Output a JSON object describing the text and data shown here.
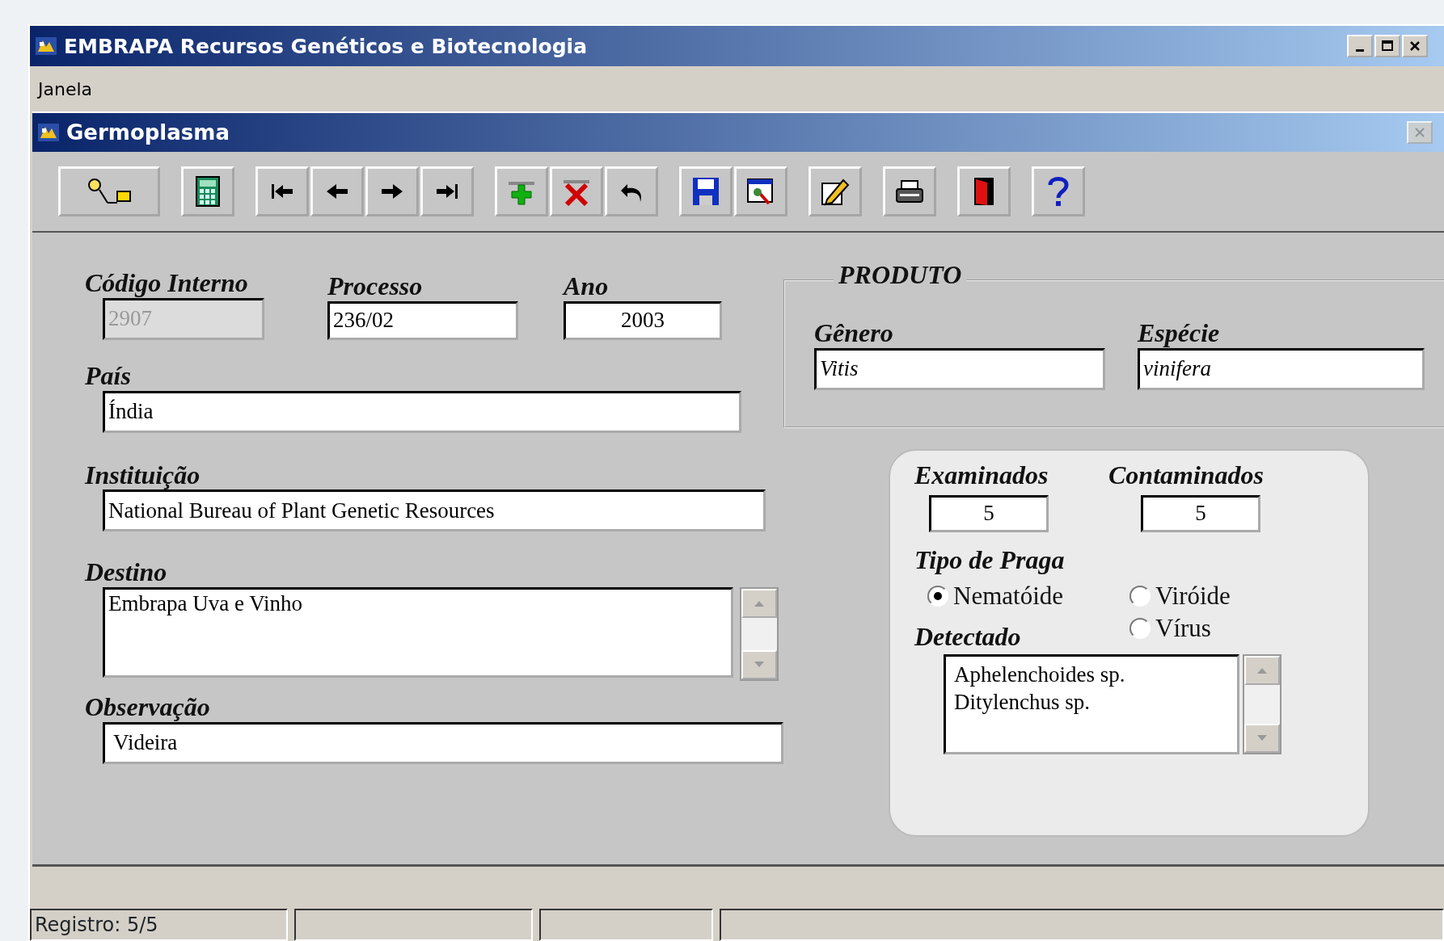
{
  "window": {
    "title": "EMBRAPA Recursos Genéticos e Biotecnologia"
  },
  "menu": [
    "Janela"
  ],
  "form_window": {
    "title": "Germoplasma"
  },
  "fields": {
    "codigo_interno": {
      "label": "Código Interno",
      "value": "2907",
      "disabled": true
    },
    "processo": {
      "label": "Processo",
      "value": "236/02"
    },
    "ano": {
      "label": "Ano",
      "value": "2003"
    },
    "pais": {
      "label": "País",
      "value": "Índia"
    },
    "instituicao": {
      "label": "Instituição",
      "value": "National Bureau of Plant Genetic Resources"
    },
    "destino": {
      "label": "Destino",
      "value": "Embrapa Uva e Vinho"
    },
    "observacao": {
      "label": "Observação",
      "value": "Videira"
    }
  },
  "produto": {
    "title": "PRODUTO",
    "genero": {
      "label": "Gênero",
      "value": "Vitis"
    },
    "especie": {
      "label": "Espécie",
      "value": "vinifera"
    }
  },
  "pest_panel": {
    "examinados": {
      "label": "Examinados",
      "value": "5"
    },
    "contaminados": {
      "label": "Contaminados",
      "value": "5"
    },
    "tipo_de_praga": {
      "label": "Tipo de Praga",
      "options": [
        {
          "label": "Nematóide",
          "selected": true
        },
        {
          "label": "Viróide",
          "selected": false
        },
        {
          "label": "Vírus",
          "selected": false
        }
      ]
    },
    "detectado": {
      "label": "Detectado",
      "lines": [
        "Aphelenchoides sp.",
        "Ditylenchus sp."
      ]
    }
  },
  "status_bar": {
    "text": "Registro: 5/5"
  }
}
